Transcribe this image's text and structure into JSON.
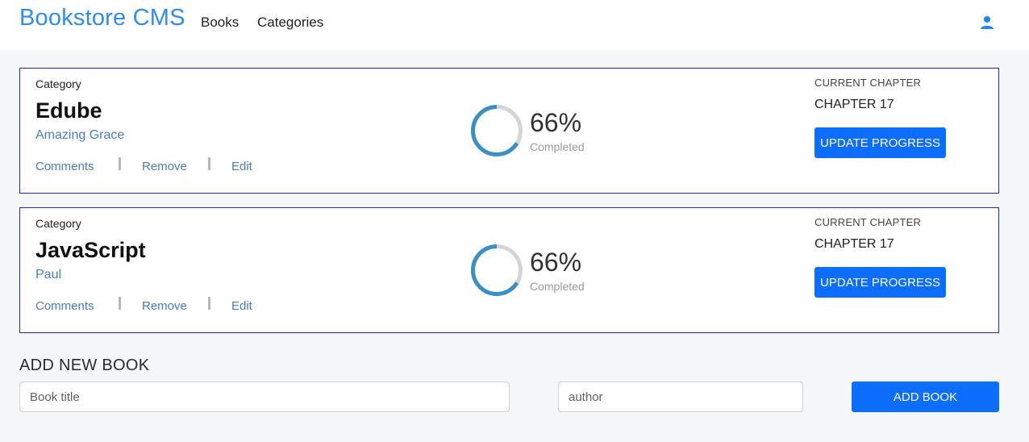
{
  "header": {
    "brand": "Bookstore CMS",
    "nav": [
      "Books",
      "Categories"
    ],
    "user_icon": "user-icon",
    "brand_color": "#2f8fe8"
  },
  "books": [
    {
      "category_label": "Category",
      "title": "Edube",
      "author": "Amazing Grace",
      "actions": [
        "Comments",
        "Remove",
        "Edit"
      ],
      "progress": 66,
      "progress_text": "66%",
      "completed_label": "Completed",
      "current_chapter_label": "CURRENT CHAPTER",
      "current_chapter": "CHAPTER 17",
      "update_label": "UPDATE PROGRESS"
    },
    {
      "category_label": "Category",
      "title": "JavaScript",
      "author": "Paul",
      "actions": [
        "Comments",
        "Remove",
        "Edit"
      ],
      "progress": 66,
      "progress_text": "66%",
      "completed_label": "Completed",
      "current_chapter_label": "CURRENT CHAPTER",
      "current_chapter": "CHAPTER 17",
      "update_label": "UPDATE PROGRESS"
    }
  ],
  "add_form": {
    "heading": "ADD NEW BOOK",
    "title_placeholder": "Book title",
    "author_placeholder": "author",
    "button_label": "ADD BOOK"
  },
  "colors": {
    "accent": "#0d6efd",
    "card_border": "#1c2ab8",
    "progress_fill": "#3a8fc7",
    "progress_track": "#d5d5d5",
    "link": "#4a7cc0"
  }
}
